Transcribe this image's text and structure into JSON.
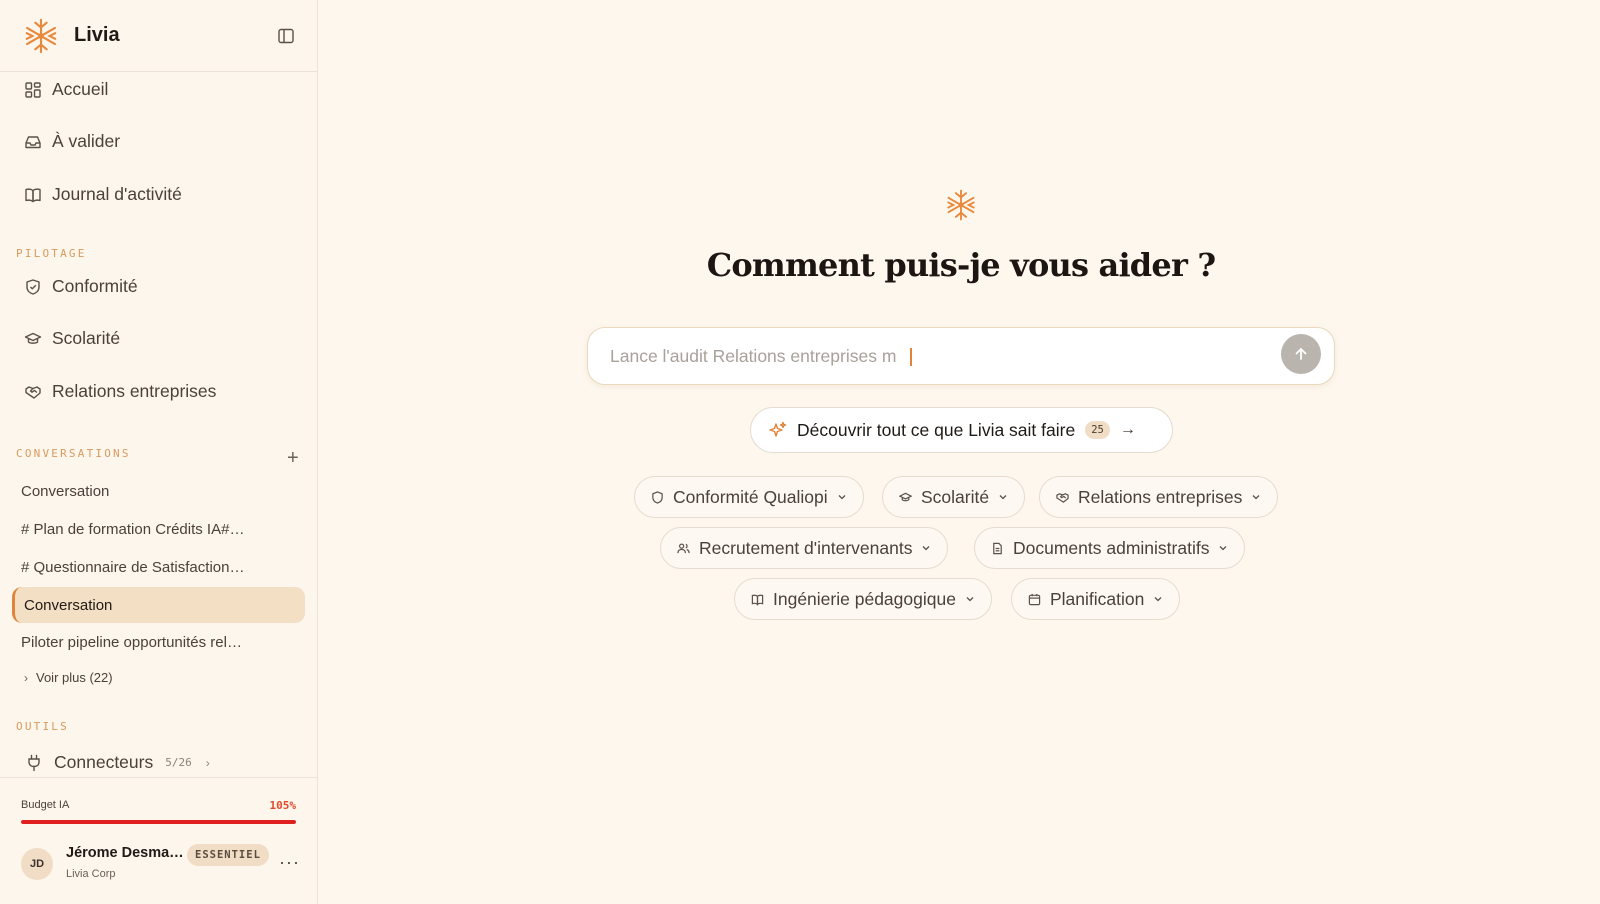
{
  "app": {
    "name": "Livia"
  },
  "sidebar": {
    "nav": [
      {
        "label": "Accueil",
        "icon": "dashboard-icon"
      },
      {
        "label": "À valider",
        "icon": "inbox-icon"
      },
      {
        "label": "Journal d'activité",
        "icon": "book-icon"
      }
    ],
    "pilotage_label": "PILOTAGE",
    "pilotage": [
      {
        "label": "Conformité",
        "icon": "shield-icon"
      },
      {
        "label": "Scolarité",
        "icon": "graduation-cap-icon"
      },
      {
        "label": "Relations entreprises",
        "icon": "handshake-icon"
      }
    ],
    "conversations_label": "CONVERSATIONS",
    "conversations": [
      "Conversation",
      "# Plan de formation Crédits IA#…",
      "# Questionnaire de Satisfaction…",
      "Conversation",
      "Piloter pipeline opportunités rel…"
    ],
    "active_conversation_index": 3,
    "voir_plus": "Voir plus (22)",
    "outils_label": "OUTILS",
    "connecteurs": {
      "label": "Connecteurs",
      "count": "5/26"
    },
    "budget": {
      "label": "Budget IA",
      "percent_text": "105%",
      "fill_fraction": 1.0
    },
    "user": {
      "initials": "JD",
      "name": "Jérome Desma…",
      "org": "Livia Corp",
      "plan": "ESSENTIEL"
    }
  },
  "main": {
    "headline": "Comment puis-je vous aider ?",
    "prompt": {
      "placeholder": "Lance l'audit Relations entreprises m"
    },
    "discover": {
      "label": "Découvrir tout ce que Livia sait faire",
      "count": "25"
    },
    "chips": [
      {
        "label": "Conformité Qualiopi",
        "icon": "shield-icon"
      },
      {
        "label": "Scolarité",
        "icon": "graduation-cap-icon"
      },
      {
        "label": "Relations entreprises",
        "icon": "handshake-icon"
      },
      {
        "label": "Recrutement d'intervenants",
        "icon": "users-icon"
      },
      {
        "label": "Documents administratifs",
        "icon": "document-icon"
      },
      {
        "label": "Ingénierie pédagogique",
        "icon": "book-icon"
      },
      {
        "label": "Planification",
        "icon": "calendar-icon"
      }
    ]
  },
  "colors": {
    "accent": "#e0843a",
    "background": "#fdf7ee",
    "budget_over": "#e01f1f"
  }
}
